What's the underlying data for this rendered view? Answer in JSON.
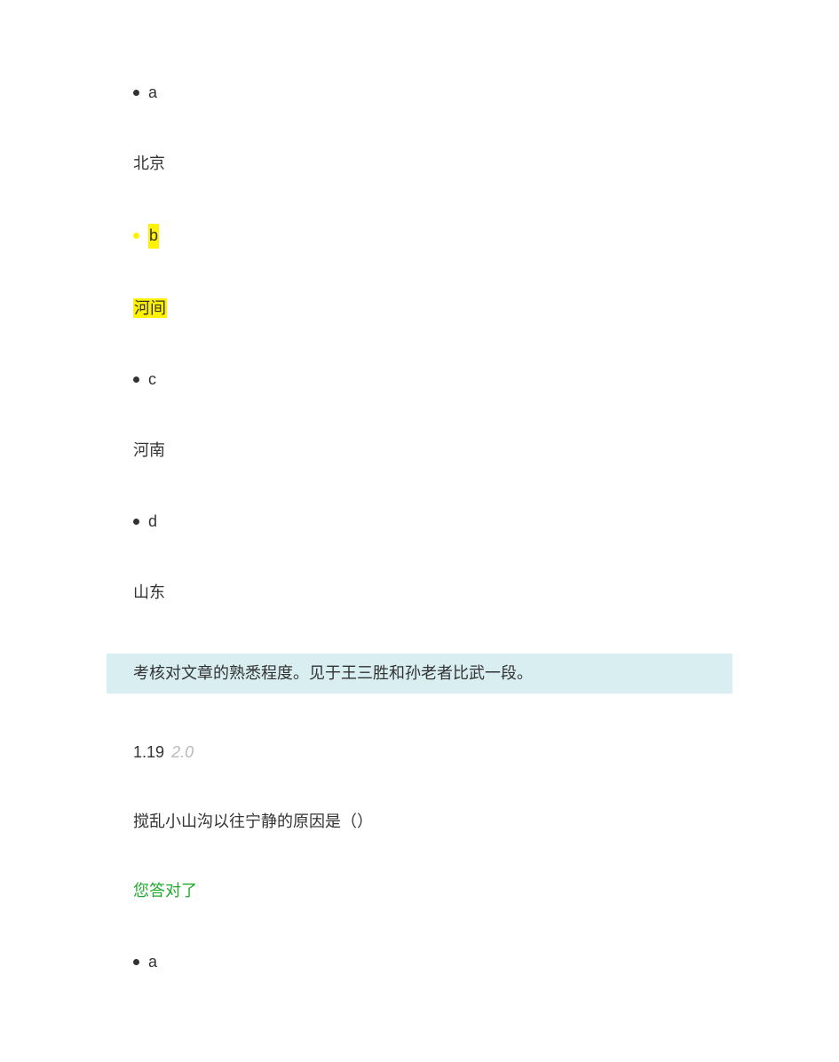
{
  "q1": {
    "options": {
      "a": {
        "letter": "a",
        "text": "北京",
        "highlighted": false
      },
      "b": {
        "letter": "b",
        "text": "河间",
        "highlighted": true
      },
      "c": {
        "letter": "c",
        "text": "河南",
        "highlighted": false
      },
      "d": {
        "letter": "d",
        "text": "山东",
        "highlighted": false
      }
    },
    "explanation": "考核对文章的熟悉程度。见于王三胜和孙老者比武一段。"
  },
  "q2": {
    "number": "1.19",
    "points": "2.0",
    "question": "搅乱小山沟以往宁静的原因是（）",
    "result": "您答对了",
    "options": {
      "a": {
        "letter": "a"
      }
    }
  }
}
